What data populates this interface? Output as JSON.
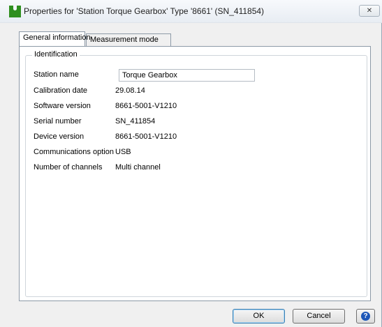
{
  "window": {
    "title": "Properties for 'Station Torque Gearbox' Type '8661'  (SN_411854)",
    "close_glyph": "✕"
  },
  "tabs": [
    {
      "label": "General information",
      "active": true
    },
    {
      "label": "Measurement mode",
      "active": false
    }
  ],
  "identification": {
    "group_title": "Identification",
    "station_name": {
      "label": "Station name",
      "value": "Torque Gearbox"
    },
    "fields": [
      {
        "label": "Calibration date",
        "value": "29.08.14"
      },
      {
        "label": "Software version",
        "value": "8661-5001-V1210"
      },
      {
        "label": "Serial number",
        "value": "SN_411854"
      },
      {
        "label": "Device version",
        "value": "8661-5001-V1210"
      },
      {
        "label": "Communications option",
        "value": "USB"
      },
      {
        "label": "Number of channels",
        "value": "Multi channel"
      }
    ]
  },
  "buttons": {
    "ok": "OK",
    "cancel": "Cancel",
    "help_icon": "help-icon"
  },
  "colors": {
    "app_icon": "#2f8f1f",
    "help_icon": "#1d57b8"
  }
}
